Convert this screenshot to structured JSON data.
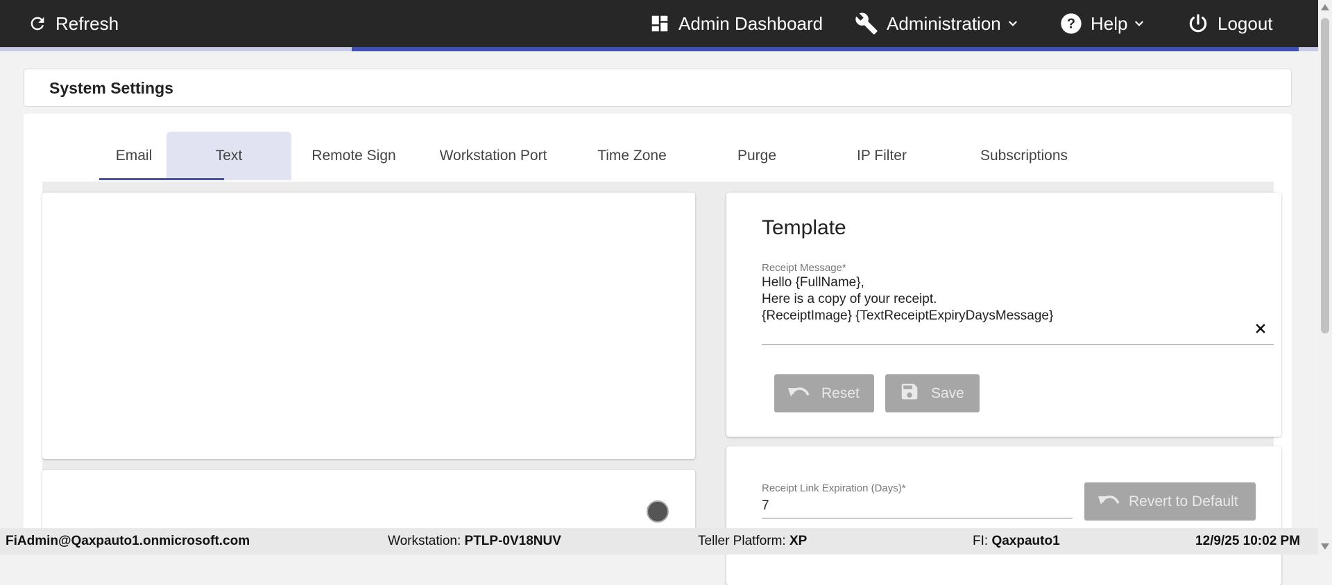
{
  "topbar": {
    "refresh_label": "Refresh",
    "admin_dashboard_label": "Admin Dashboard",
    "administration_label": "Administration",
    "help_label": "Help",
    "logout_label": "Logout",
    "progress_fraction": 0.73
  },
  "page": {
    "title": "System Settings"
  },
  "tabs": [
    {
      "label": "Email"
    },
    {
      "label": "Text",
      "active": true
    },
    {
      "label": "Remote Sign"
    },
    {
      "label": "Workstation Port"
    },
    {
      "label": "Time Zone"
    },
    {
      "label": "Purge"
    },
    {
      "label": "IP Filter"
    },
    {
      "label": "Subscriptions"
    }
  ],
  "template": {
    "heading": "Template",
    "receipt_message_label": "Receipt Message*",
    "receipt_message_lines": [
      "Hello {FullName},",
      "Here is a copy of your receipt.",
      "{ReceiptImage} {TextReceiptExpiryDaysMessage}"
    ],
    "reset_label": "Reset",
    "save_label": "Save"
  },
  "expiration": {
    "label": "Receipt Link Expiration (Days)*",
    "value": "7",
    "revert_label": "Revert to Default"
  },
  "footer": {
    "user": "FiAdmin@Qaxpauto1.onmicrosoft.com",
    "workstation_label": "Workstation:",
    "workstation_value": "PTLP-0V18NUV",
    "teller_label": "Teller Platform:",
    "teller_value": "XP",
    "fi_label": "FI:",
    "fi_value": "Qaxpauto1",
    "datetime": "12/9/25 10:02 PM"
  },
  "colors": {
    "topbar_bg": "#272727",
    "accent": "#3f51b5",
    "active_tab_bg": "#e1e3f3",
    "disabled_button": "#a6a6a6"
  },
  "icons": {
    "refresh": "refresh-icon",
    "dashboard": "dashboard-icon",
    "administration": "wrench-icon",
    "help": "help-circle-icon",
    "logout": "power-icon",
    "clear": "close-icon",
    "reset": "undo-icon",
    "save": "floppy-disk-icon",
    "revert": "undo-icon"
  }
}
